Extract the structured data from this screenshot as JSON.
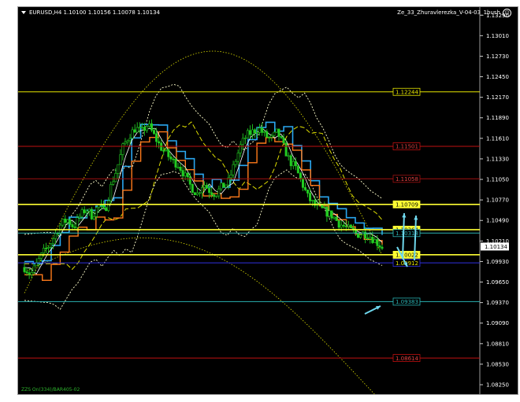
{
  "header": {
    "symbol_info": "EURUSD,H4  1.10100 1.10156 1.10078 1.10134",
    "indicator_name": "Ze_33_Zhuravlerezka_V-04-03_1bush"
  },
  "footer": {
    "text": "ZZS On(334)/BAR405-02"
  },
  "colors": {
    "background": "#000000",
    "candle": "#22cc22",
    "blue_line": "#2aa7f0",
    "orange_line": "#ff7a1a",
    "white_line": "#ffffff",
    "envelope": "#ffffcc",
    "dashed_yellow": "#dede00",
    "arrow": "#6fd8ee"
  },
  "price_axis": {
    "ticks": [
      "1.13290",
      "1.13010",
      "1.12730",
      "1.12450",
      "1.12170",
      "1.11890",
      "1.11610",
      "1.11330",
      "1.11050",
      "1.10770",
      "1.10490",
      "1.10210",
      "1.09930",
      "1.09650",
      "1.09370",
      "1.09090",
      "1.08810",
      "1.08530",
      "1.08250"
    ],
    "current_price": "1.10134"
  },
  "levels": [
    {
      "label": "1.12244",
      "value": 1.12244,
      "color": "#e6e600",
      "text_color": "#e6e600"
    },
    {
      "label": "1.11501",
      "value": 1.11501,
      "color": "#c01010",
      "text_color": "#e04040"
    },
    {
      "label": "1.11058",
      "value": 1.11058,
      "color": "#a01010",
      "text_color": "#e04040"
    },
    {
      "label": "1.10709",
      "value": 1.10709,
      "color": "#ffff33",
      "text_color": "#000000",
      "filled": true
    },
    {
      "label": "1.10364",
      "value": 1.10364,
      "color": "#ffff33",
      "text_color": "#000000",
      "filled": true
    },
    {
      "label": "1.10318",
      "value": 1.10318,
      "color": "#2ab3b3",
      "text_color": "#2ab3b3"
    },
    {
      "label": "1.10022",
      "value": 1.10022,
      "color": "#ffff33",
      "text_color": "#000000",
      "filled": true
    },
    {
      "label": "1.09912",
      "value": 1.09912,
      "color": "#3030e0",
      "text_color": "#e6e600"
    },
    {
      "label": "1.09383",
      "value": 1.09383,
      "color": "#2ab3b3",
      "text_color": "#2ab3b3"
    },
    {
      "label": "1.08614",
      "value": 1.08614,
      "color": "#c01010",
      "text_color": "#e04040"
    }
  ],
  "chart_data": {
    "type": "candlestick",
    "symbol": "EURUSD",
    "timeframe": "H4",
    "ylim": [
      1.081,
      1.134
    ],
    "close_path": [
      1.0985,
      1.0975,
      1.099,
      1.1005,
      1.1015,
      1.103,
      1.1045,
      1.105,
      1.104,
      1.1055,
      1.1065,
      1.1055,
      1.107,
      1.106,
      1.1095,
      1.112,
      1.115,
      1.1165,
      1.1175,
      1.117,
      1.118,
      1.1165,
      1.115,
      1.114,
      1.113,
      1.1125,
      1.111,
      1.1095,
      1.1085,
      1.11,
      1.109,
      1.1085,
      1.1095,
      1.11,
      1.1125,
      1.115,
      1.1165,
      1.117,
      1.1175,
      1.1165,
      1.116,
      1.117,
      1.115,
      1.113,
      1.112,
      1.11,
      1.108,
      1.107,
      1.1065,
      1.106,
      1.1055,
      1.1045,
      1.104,
      1.1035,
      1.103,
      1.1032,
      1.1028,
      1.102,
      1.1013
    ]
  }
}
